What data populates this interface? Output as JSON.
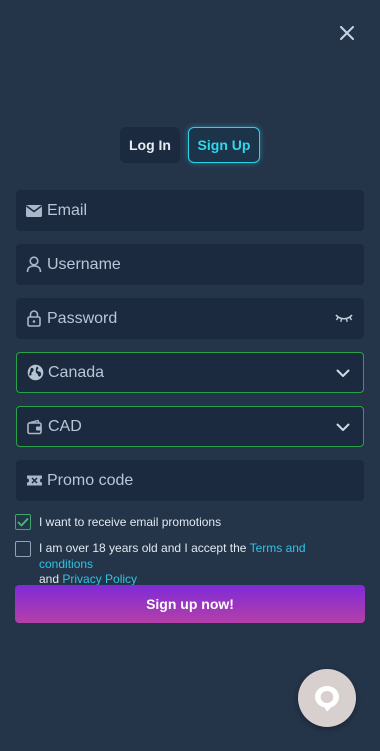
{
  "tabs": {
    "login": "Log In",
    "signup": "Sign Up"
  },
  "fields": {
    "email": {
      "placeholder": "Email",
      "icon": "envelope-icon"
    },
    "username": {
      "placeholder": "Username",
      "icon": "user-icon"
    },
    "password": {
      "placeholder": "Password",
      "icon": "lock-icon",
      "toggle_icon": "eye-closed-icon"
    },
    "country": {
      "value": "Canada",
      "icon": "globe-icon"
    },
    "currency": {
      "value": "CAD",
      "icon": "wallet-icon"
    },
    "promo": {
      "placeholder": "Promo code",
      "icon": "ticket-icon"
    }
  },
  "consent": {
    "email_promotions": {
      "checked": true,
      "label": "I want to receive email promotions"
    },
    "age_terms": {
      "checked": false,
      "text_before": "I am over 18 years old and I accept the ",
      "terms_link": "Terms and conditions",
      "text_middle": " and ",
      "privacy_link": "Privacy Policy"
    }
  },
  "submit_label": "Sign up now!",
  "colors": {
    "background": "#243449",
    "accent": "#2fd8ea",
    "valid_border": "#2aa24c",
    "gradient_start": "#7f2bd8",
    "gradient_end": "#b43fa8"
  }
}
